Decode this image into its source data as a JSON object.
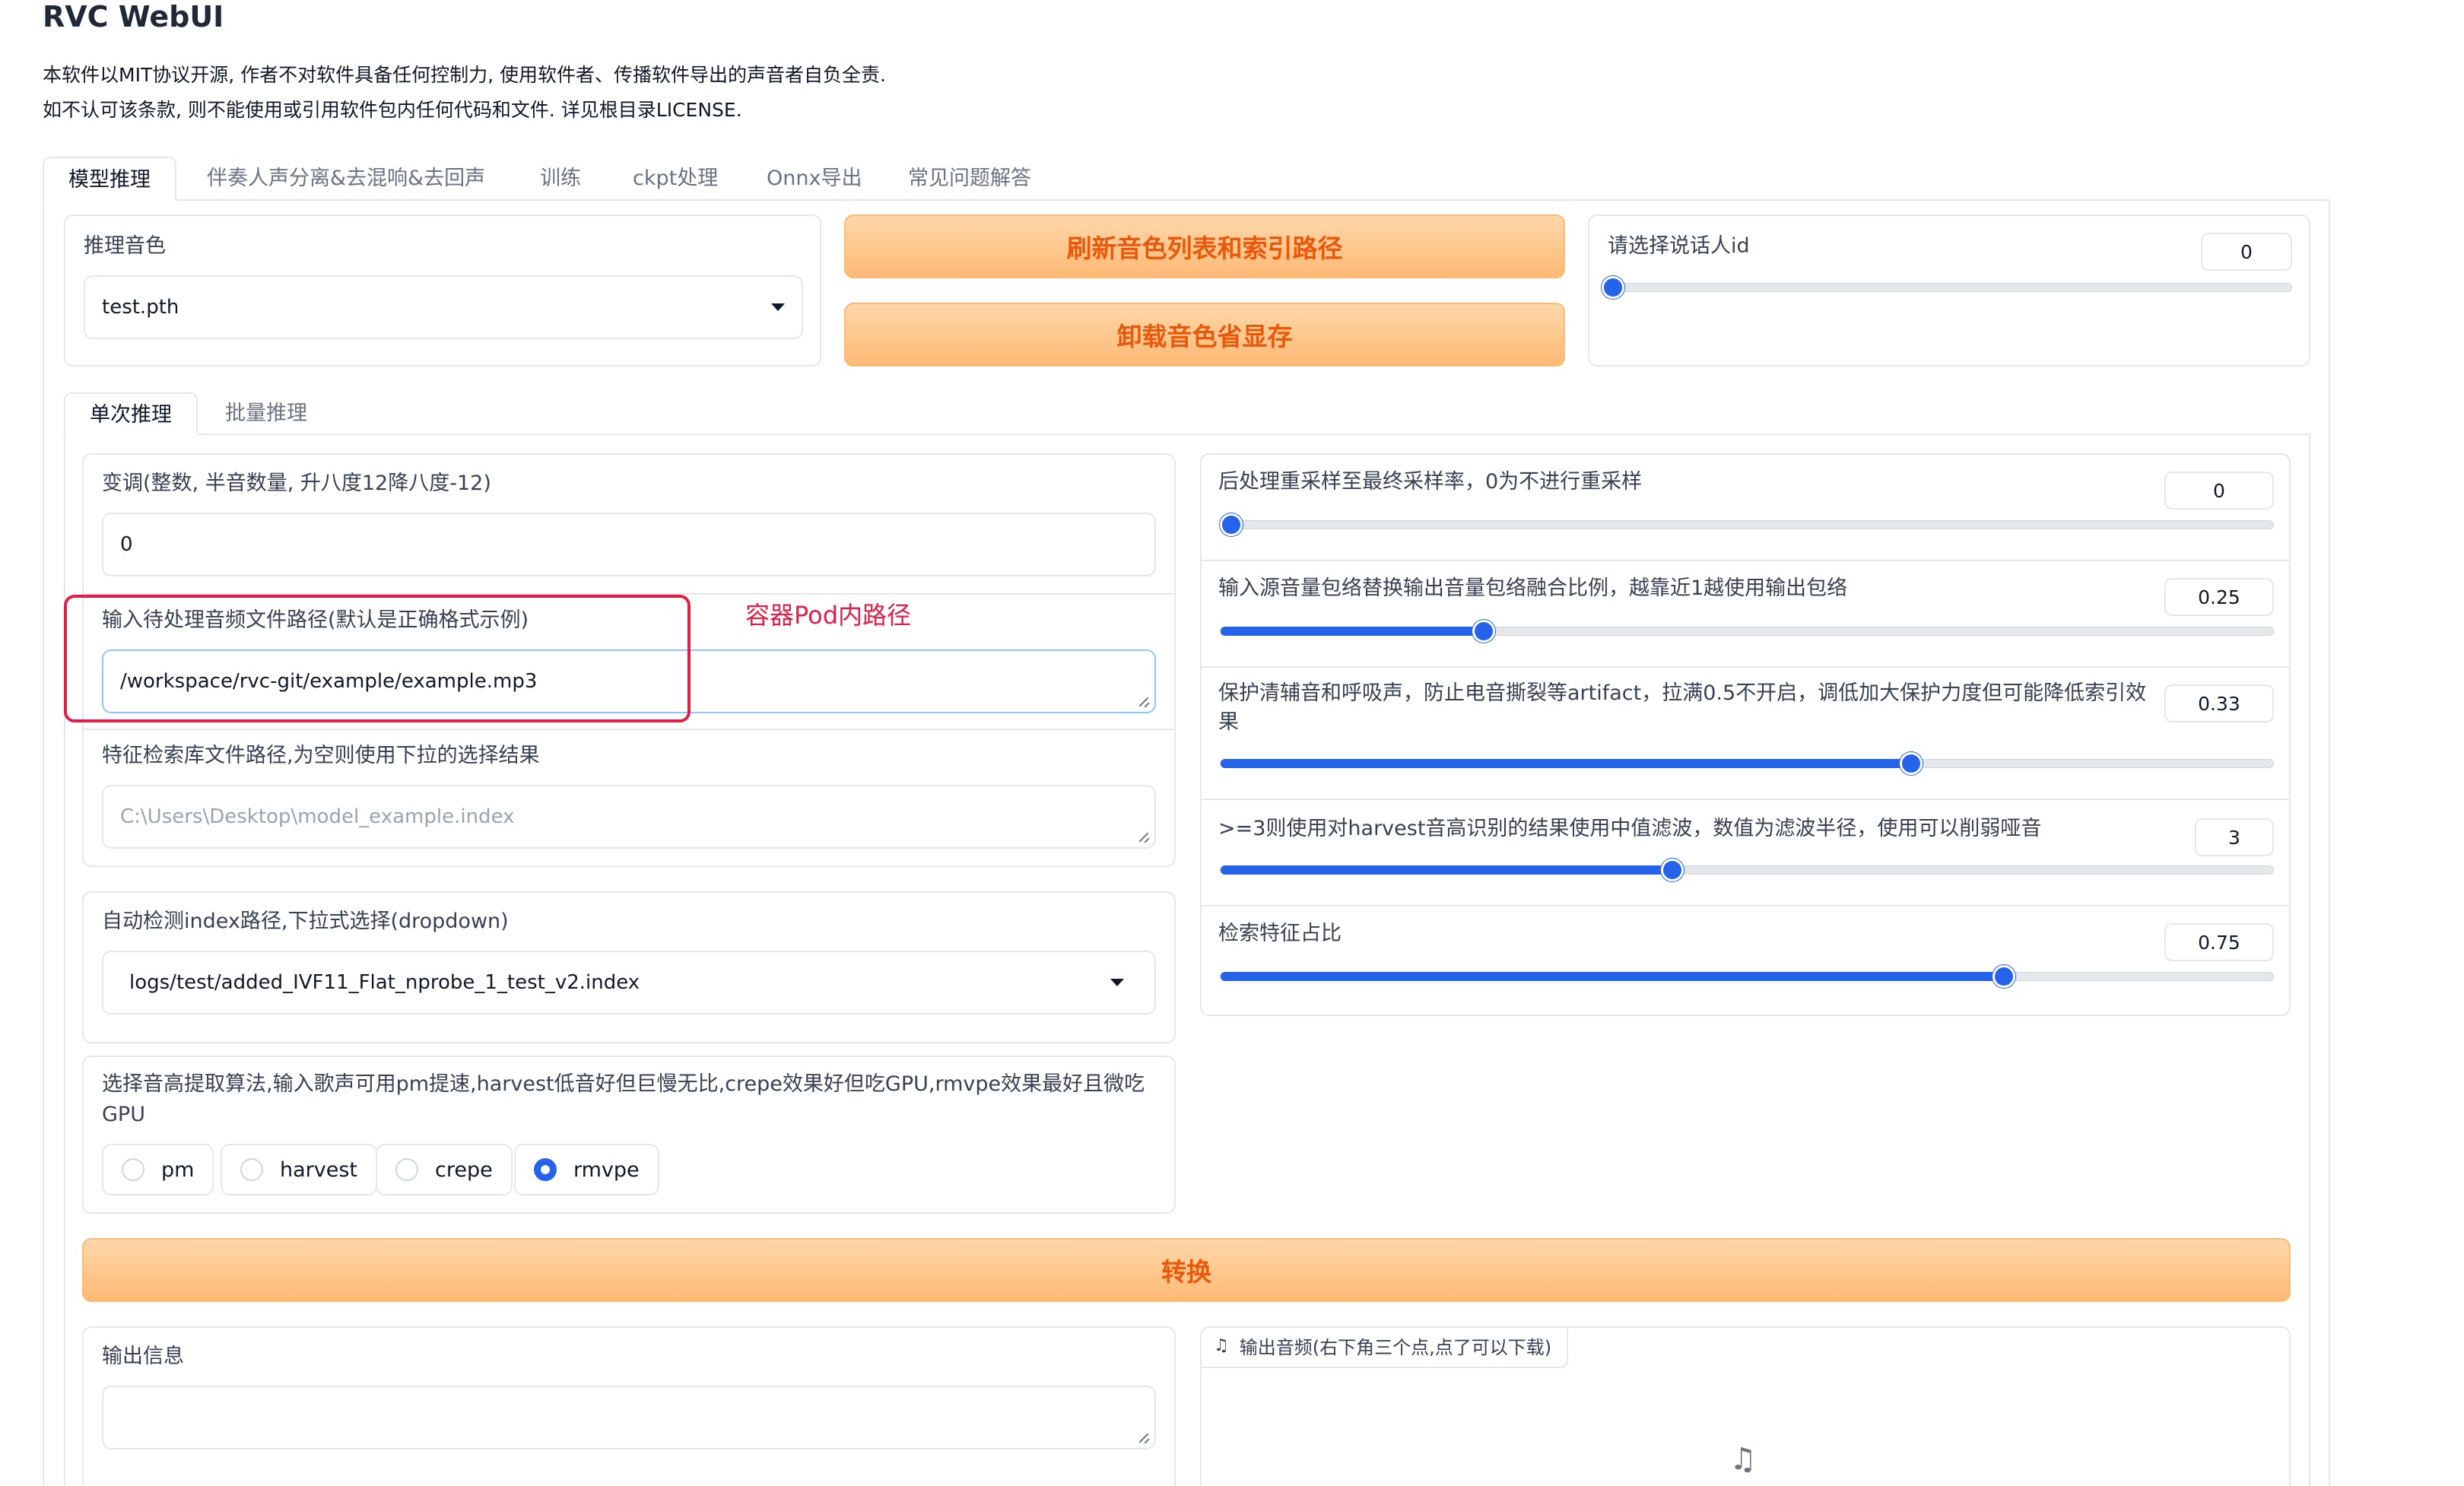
{
  "app": {
    "title": "RVC WebUI",
    "license_line1": "本软件以MIT协议开源, 作者不对软件具备任何控制力, 使用软件者、传播软件导出的声音者自负全责.",
    "license_line2": "如不认可该条款, 则不能使用或引用软件包内任何代码和文件. 详见根目录LICENSE."
  },
  "main_tabs": [
    {
      "label": "模型推理"
    },
    {
      "label": "伴奏人声分离&去混响&去回声"
    },
    {
      "label": "训练"
    },
    {
      "label": "ckpt处理"
    },
    {
      "label": "Onnx导出"
    },
    {
      "label": "常见问题解答"
    }
  ],
  "model": {
    "label": "推理音色",
    "selected": "test.pth",
    "refresh_button": "刷新音色列表和索引路径",
    "unload_button": "卸载音色省显存",
    "speaker_label": "请选择说话人id",
    "speaker_value": "0",
    "speaker_fraction": 0
  },
  "sub_tabs": [
    {
      "label": "单次推理"
    },
    {
      "label": "批量推理"
    }
  ],
  "transpose": {
    "label": "变调(整数, 半音数量, 升八度12降八度-12)",
    "value": "0"
  },
  "input_path": {
    "label": "输入待处理音频文件路径(默认是正确格式示例)",
    "value": "/workspace/rvc-git/example/example.mp3"
  },
  "annotation": {
    "text": "容器Pod内路径",
    "color": "#e11d48"
  },
  "index_path": {
    "label": "特征检索库文件路径,为空则使用下拉的选择结果",
    "placeholder": "C:\\Users\\Desktop\\model_example.index"
  },
  "auto_index": {
    "label": "自动检测index路径,下拉式选择(dropdown)",
    "selected": "logs/test/added_IVF11_Flat_nprobe_1_test_v2.index"
  },
  "f0_method": {
    "label_line1": "选择音高提取算法,输入歌声可用pm提速,harvest低音好但巨慢无比,crepe效果好但吃GPU,rmvpe效果最好且微吃",
    "label_line2": "GPU",
    "options": [
      "pm",
      "harvest",
      "crepe",
      "rmvpe"
    ],
    "selected": "rmvpe"
  },
  "sliders": [
    {
      "label": "后处理重采样至最终采样率，0为不进行重采样",
      "label2": "",
      "value": "0",
      "fraction": 0.0
    },
    {
      "label": "输入源音量包络替换输出音量包络融合比例，越靠近1越使用输出包络",
      "label2": "",
      "value": "0.25",
      "fraction": 0.25
    },
    {
      "label": "保护清辅音和呼吸声，防止电音撕裂等artifact，拉满0.5不开启，调低加大保护力度但可能降低索引效",
      "label2": "果",
      "value": "0.33",
      "fraction": 0.656
    },
    {
      "label": ">=3则使用对harvest音高识别的结果使用中值滤波，数值为滤波半径，使用可以削弱哑音",
      "label2": "",
      "value": "3",
      "fraction": 0.429
    },
    {
      "label": "检索特征占比",
      "label2": "",
      "value": "0.75",
      "fraction": 0.744
    }
  ],
  "convert_button": "转换",
  "output": {
    "info_label": "输出信息",
    "audio_label": "输出音频(右下角三个点,点了可以下载)"
  },
  "colors": {
    "accent": "#2563eb",
    "orange_text": "#ea580c",
    "orange_bg": "#fdba74"
  }
}
